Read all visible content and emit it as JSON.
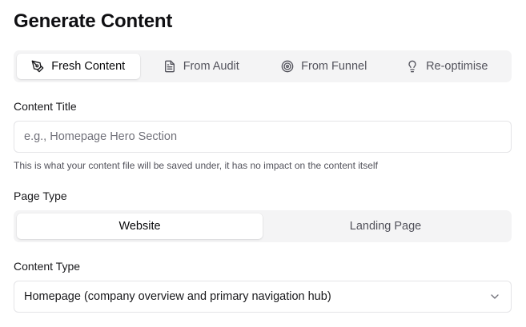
{
  "page": {
    "title": "Generate Content"
  },
  "source_tabs": [
    {
      "label": "Fresh Content",
      "icon": "pen-nib-icon",
      "active": true
    },
    {
      "label": "From Audit",
      "icon": "document-icon",
      "active": false
    },
    {
      "label": "From Funnel",
      "icon": "target-icon",
      "active": false
    },
    {
      "label": "Re-optimise",
      "icon": "lightbulb-icon",
      "active": false
    }
  ],
  "content_title": {
    "label": "Content Title",
    "value": "",
    "placeholder": "e.g., Homepage Hero Section",
    "helper": "This is what your content file will be saved under, it has no impact on the content itself"
  },
  "page_type": {
    "label": "Page Type",
    "options": [
      "Website",
      "Landing Page"
    ],
    "selected": "Website"
  },
  "content_type": {
    "label": "Content Type",
    "selected": "Homepage (company overview and primary navigation hub)",
    "icon": "chevron-down-icon"
  }
}
